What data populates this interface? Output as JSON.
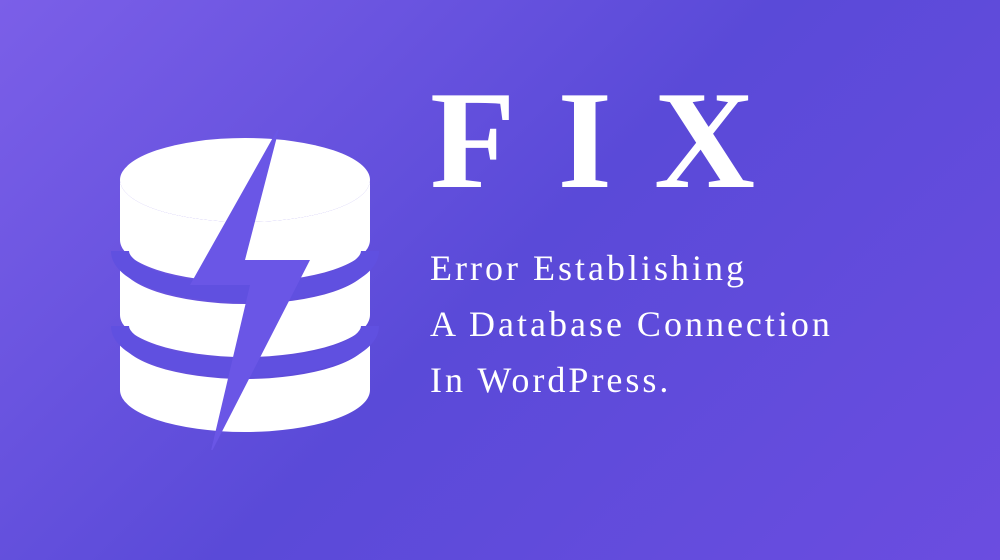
{
  "heading": "FIX",
  "subtitle_line1": "Error Establishing",
  "subtitle_line2": "A Database Connection",
  "subtitle_line3": "In WordPress.",
  "icon_name": "database-lightning"
}
